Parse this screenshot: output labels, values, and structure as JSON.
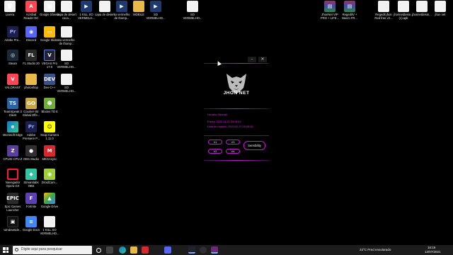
{
  "desktop": {
    "icons": [
      {
        "label": "Lixeira",
        "glyph": "🗑",
        "cls": "g-file"
      },
      {
        "label": "Acrobat Reader DC",
        "glyph": "A",
        "cls": "g-val"
      },
      {
        "label": "Google Sheets",
        "glyph": "▦",
        "cls": "g-file"
      },
      {
        "label": "capa de desert coca...",
        "glyph": "",
        "cls": "g-file"
      },
      {
        "label": "1 KILL SO VERMELH...",
        "glyph": "▶",
        "cls": "g-img"
      },
      {
        "label": "capa de desert ...",
        "glyph": "",
        "cls": "g-file"
      },
      {
        "label": "so vermelho de thomp...",
        "glyph": "▶",
        "cls": "g-img"
      },
      {
        "label": "MOBILE",
        "glyph": "",
        "cls": "g-folder"
      },
      {
        "label": "SO VERMELHO...",
        "glyph": "▶",
        "cls": "g-img"
      },
      {
        "label": "SO VERMELHO...",
        "glyph": "",
        "cls": "g-file"
      },
      {
        "label": "Adobe Pre...",
        "glyph": "Pr",
        "cls": "g-pr"
      },
      {
        "label": "Discord",
        "glyph": "◉",
        "cls": "g-disc"
      },
      {
        "label": "Google Slides",
        "glyph": "▭",
        "cls": "g-gsl"
      },
      {
        "label": "so vermelho de thomp...",
        "glyph": "",
        "cls": "g-file"
      },
      {
        "label": "Steam",
        "glyph": "◎",
        "cls": "g-steam"
      },
      {
        "label": "FL Studio 20",
        "glyph": "FL",
        "cls": "g-fl"
      },
      {
        "label": "VEGAS Pro 17.0",
        "glyph": "V",
        "cls": "g-vegas"
      },
      {
        "label": "SO VERMELHO...",
        "glyph": "",
        "cls": "g-file"
      },
      {
        "label": "VALORANT",
        "glyph": "V",
        "cls": "g-val"
      },
      {
        "label": "photoshop",
        "glyph": "",
        "cls": "g-folder"
      },
      {
        "label": "Dev-C++",
        "glyph": "DEV",
        "cls": "g-dev"
      },
      {
        "label": "SO VERMELHO...",
        "glyph": "",
        "cls": "g-file"
      },
      {
        "label": "TeamSpeak 3 Client",
        "glyph": "TS",
        "cls": "g-ts"
      },
      {
        "label": "Counter-Str Global Offe...",
        "glyph": "GO",
        "cls": "g-cs"
      },
      {
        "label": "Bloons TD 6",
        "glyph": "☻",
        "cls": "g-btd"
      },
      {
        "label": "Microsoft Edge",
        "glyph": "e",
        "cls": "g-edge"
      },
      {
        "label": "Adobe Premiere P...",
        "glyph": "Pr",
        "cls": "g-pr"
      },
      {
        "label": "Snap Camera 1.11.0",
        "glyph": "☺",
        "cls": "g-snap"
      },
      {
        "label": "CPUID CPU-Z",
        "glyph": "Z",
        "cls": "g-cpuz"
      },
      {
        "label": "OBS Studio",
        "glyph": "●",
        "cls": "g-obs"
      },
      {
        "label": "MEGAsync",
        "glyph": "M",
        "cls": "g-mega"
      },
      {
        "label": "Navegador Opera GX",
        "glyph": "",
        "cls": "g-opera"
      },
      {
        "label": "Streamlabs OBS",
        "glyph": "◆",
        "cls": "g-streamlabs"
      },
      {
        "label": "DroidCam...",
        "glyph": "◉",
        "cls": "g-droid"
      },
      {
        "label": "Epic Games Launcher",
        "glyph": "EPIC",
        "cls": "g-epic"
      },
      {
        "label": "Fortnite",
        "glyph": "F",
        "cls": "g-fortnite"
      },
      {
        "label": "Google Drive",
        "glyph": "▲",
        "cls": "g-gdrive"
      },
      {
        "label": "windowside...",
        "glyph": "▣",
        "cls": "g-cursor"
      },
      {
        "label": "Google Docs",
        "glyph": "≡",
        "cls": "g-gdocs"
      },
      {
        "label": "1 KILL SO VERMELHO...",
        "glyph": "",
        "cls": "g-file"
      },
      {
        "label": "JhonNet VIP PRO + LIFE...",
        "glyph": "▤",
        "cls": "g-rar"
      },
      {
        "label": "RegeditV + Macro FR...",
        "glyph": "▤",
        "cls": "g-rar"
      },
      {
        "label": "Regedit jhon Red free v2...",
        "glyph": "",
        "cls": "g-file"
      },
      {
        "label": "jhonnetdesm... (1).apk",
        "glyph": "",
        "cls": "g-file"
      },
      {
        "label": "jhonnetdesm...",
        "glyph": "",
        "cls": "g-file"
      },
      {
        "label": "jhon net",
        "glyph": "",
        "cls": "g-file"
      }
    ]
  },
  "window": {
    "minimize": "–",
    "close": "✕",
    "brand": "JHON NET",
    "user_label": "Usuário: Beezan",
    "expiry_label": "Expiry: 2020-11-21 05:28:42",
    "reg_date_label": "Data de registro: 2020-02-27 05:28:42",
    "buttons": [
      "V1",
      "V3",
      "V2",
      "V4"
    ],
    "sensibility": "Sensibility"
  },
  "taskbar": {
    "search_placeholder": "Digite aqui para pesquisar",
    "weather": "23°C  Pred ensolarado",
    "time": "16:16",
    "date": "12/07/2021"
  }
}
